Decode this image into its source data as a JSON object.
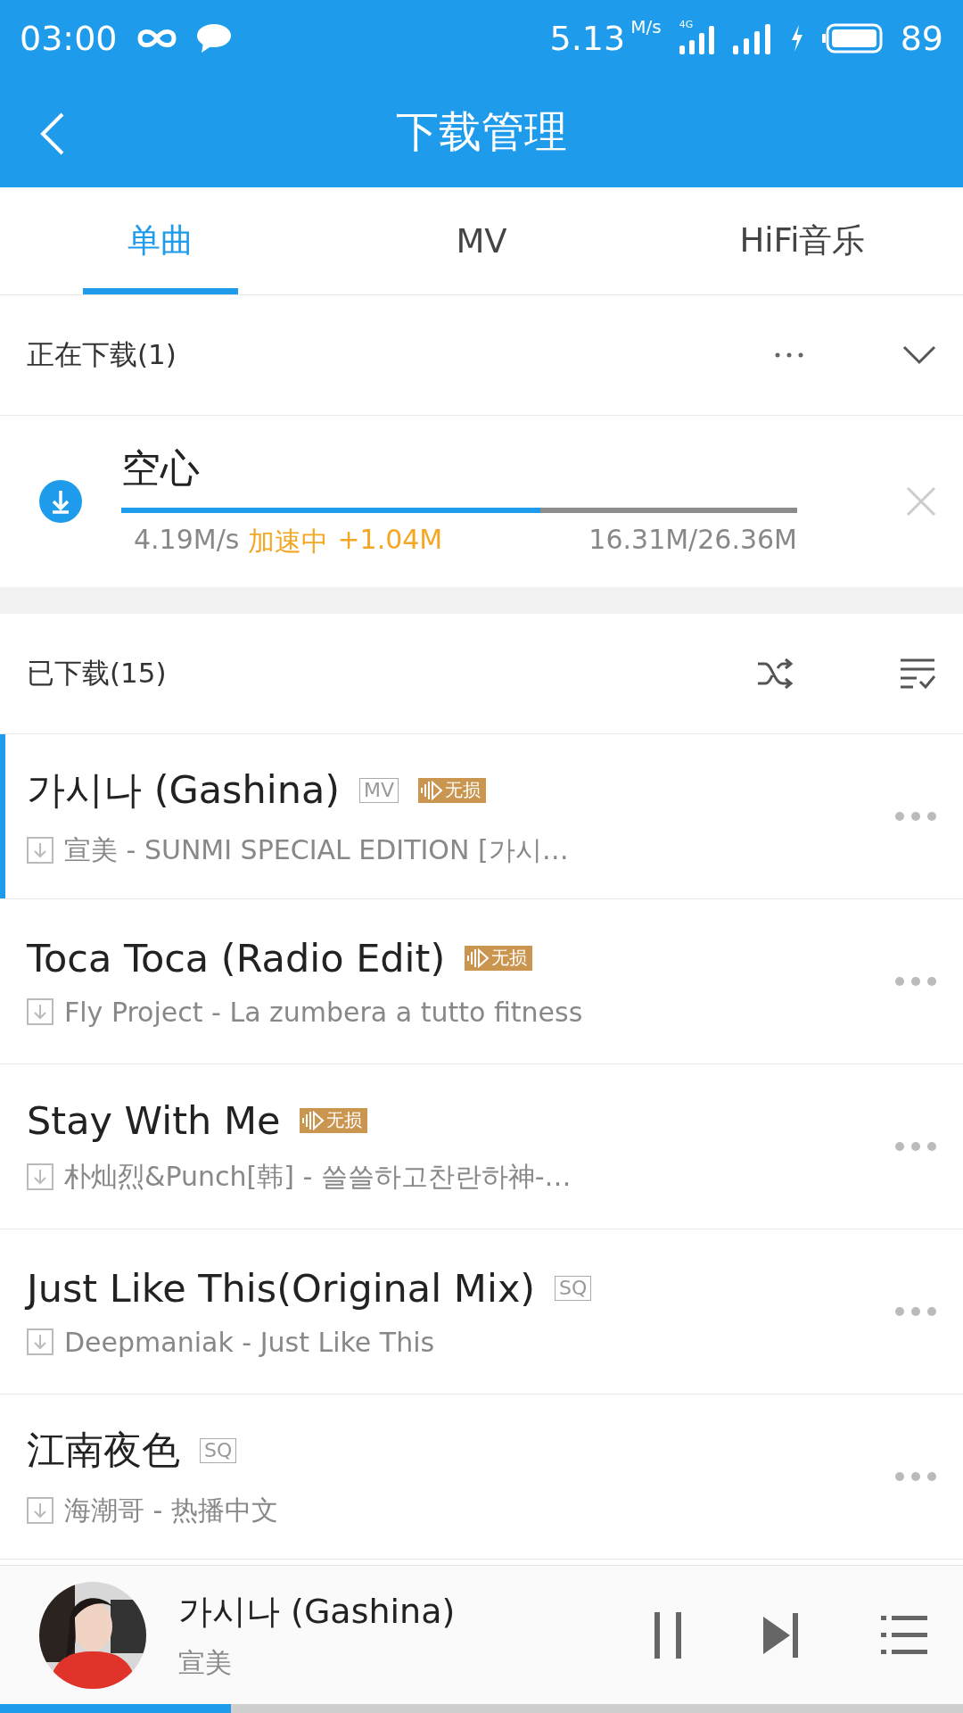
{
  "status_bar": {
    "time": "03:00",
    "net_speed": "5.13",
    "net_speed_unit": "M/s",
    "network_type": "4G",
    "battery": "89",
    "charging": true
  },
  "header": {
    "title": "下载管理"
  },
  "tabs": [
    {
      "label": "单曲",
      "selected": true
    },
    {
      "label": "MV",
      "selected": false
    },
    {
      "label": "HiFi音乐",
      "selected": false
    }
  ],
  "downloading": {
    "title": "正在下载(1)",
    "items": [
      {
        "title": "空心",
        "level": 0.62,
        "speed": "4.19M/s",
        "boost_label": "加速中",
        "boost_amount": "+1.04M",
        "size": "16.31M/26.36M"
      }
    ]
  },
  "downloaded": {
    "title": "已下载(15)",
    "songs": [
      {
        "title": "가시나 (Gashina)",
        "badges": [
          {
            "kind": "mv",
            "label": "MV"
          },
          {
            "kind": "lossless",
            "label": "无损"
          }
        ],
        "subtitle": "宣美 - SUNMI SPECIAL EDITION [가시…",
        "playing": true
      },
      {
        "title": "Toca Toca (Radio Edit)",
        "badges": [
          {
            "kind": "lossless",
            "label": "无损"
          }
        ],
        "subtitle": "Fly Project - La zumbera a tutto fitness",
        "playing": false
      },
      {
        "title": "Stay With Me",
        "badges": [
          {
            "kind": "lossless",
            "label": "无损"
          }
        ],
        "subtitle": "朴灿烈&Punch[韩] - 쓸쓸하고찬란하神-…",
        "playing": false
      },
      {
        "title": "Just Like This(Original Mix)",
        "badges": [
          {
            "kind": "sq",
            "label": "SQ"
          }
        ],
        "subtitle": "Deepmaniak - Just Like This",
        "playing": false
      },
      {
        "title": "江南夜色",
        "badges": [
          {
            "kind": "sq",
            "label": "SQ"
          }
        ],
        "subtitle": "海潮哥 - 热播中文",
        "playing": false
      }
    ]
  },
  "player": {
    "title": "가시나 (Gashina)",
    "artist": "宣美",
    "playing": true,
    "level": 0.24
  }
}
